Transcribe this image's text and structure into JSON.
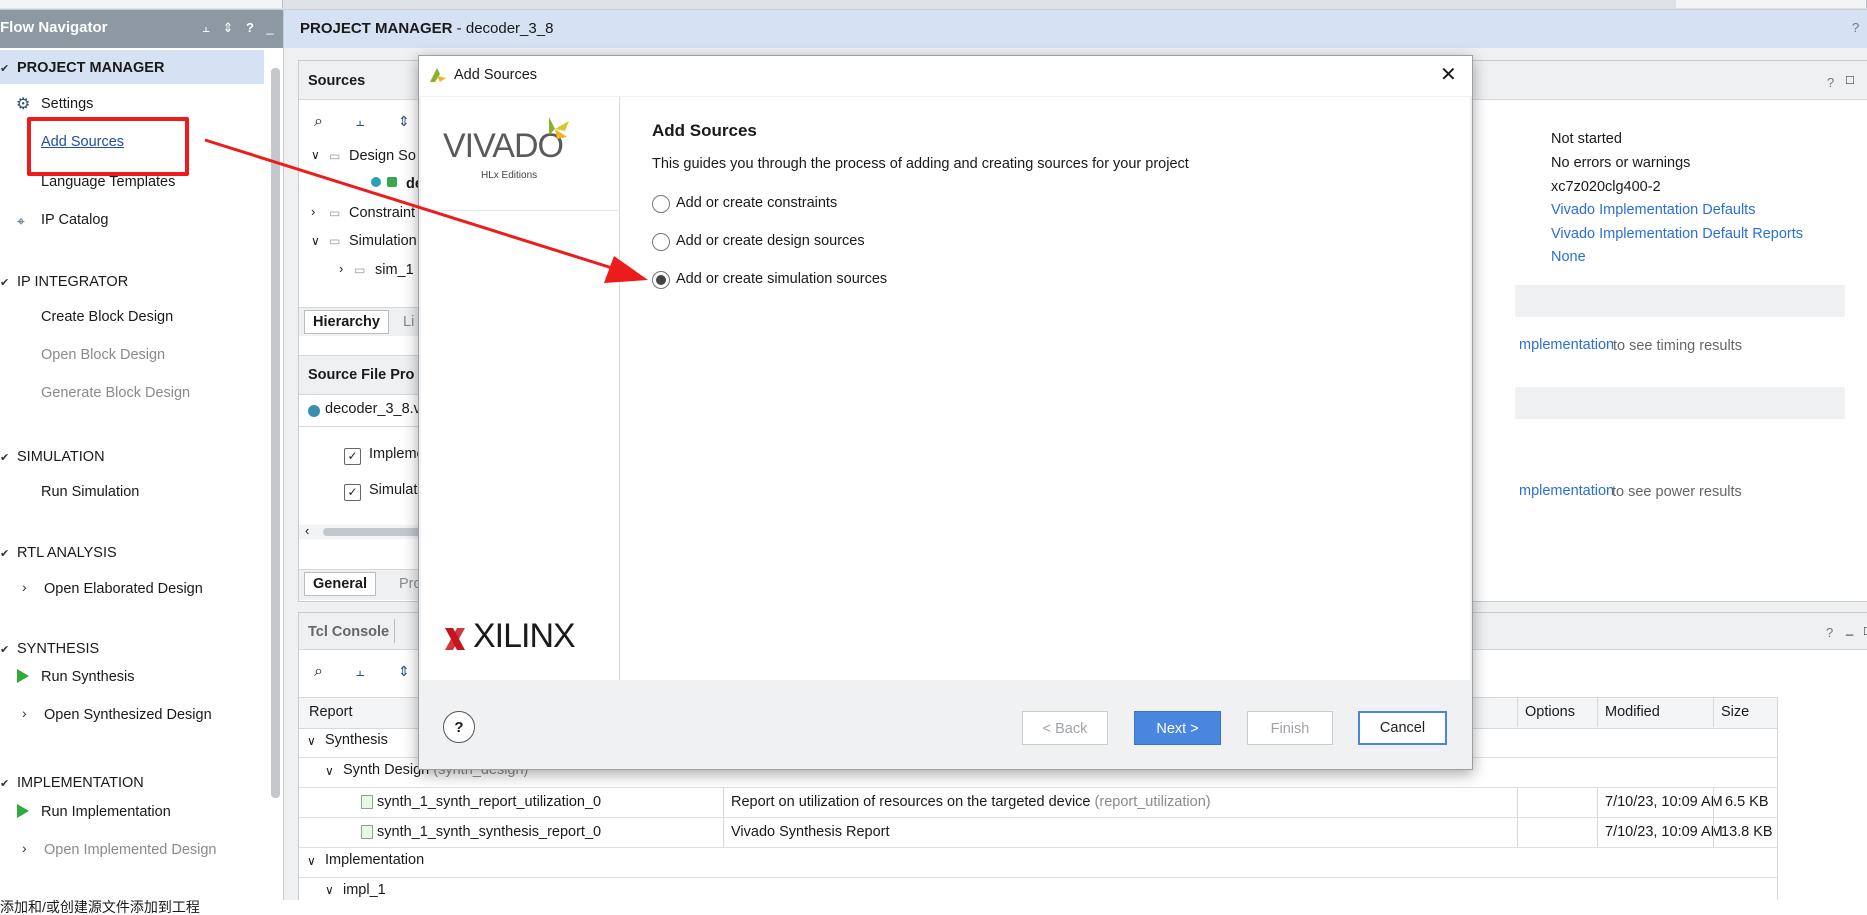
{
  "flow_navigator": {
    "title": "Flow Navigator",
    "sections": [
      {
        "id": "pm",
        "label": "PROJECT MANAGER",
        "items": [
          {
            "label": "Settings",
            "icon": "gear-icon"
          },
          {
            "label": "Add Sources"
          },
          {
            "label": "Language Templates"
          },
          {
            "label": "IP Catalog",
            "icon": "ip-catalog-icon"
          }
        ]
      },
      {
        "id": "ipi",
        "label": "IP INTEGRATOR",
        "items": [
          {
            "label": "Create Block Design"
          },
          {
            "label": "Open Block Design"
          },
          {
            "label": "Generate Block Design"
          }
        ]
      },
      {
        "id": "sim",
        "label": "SIMULATION",
        "items": [
          {
            "label": "Run Simulation"
          }
        ]
      },
      {
        "id": "rtl",
        "label": "RTL ANALYSIS",
        "items": [
          {
            "label": "Open Elaborated Design"
          }
        ]
      },
      {
        "id": "syn",
        "label": "SYNTHESIS",
        "items": [
          {
            "label": "Run Synthesis"
          },
          {
            "label": "Open Synthesized Design"
          }
        ]
      },
      {
        "id": "impl",
        "label": "IMPLEMENTATION",
        "items": [
          {
            "label": "Run Implementation"
          },
          {
            "label": "Open Implemented Design"
          }
        ]
      }
    ]
  },
  "main_header": {
    "bold": "PROJECT MANAGER",
    "rest": " - decoder_3_8"
  },
  "sources_panel": {
    "title": "Sources",
    "tree": [
      {
        "label": "Design So"
      },
      {
        "label": "dec"
      },
      {
        "label": "Constraint"
      },
      {
        "label": "Simulation"
      },
      {
        "label": "sim_1"
      }
    ],
    "tab_hierarchy": "Hierarchy",
    "tab_li": "Li"
  },
  "source_file_props": {
    "title": "Source File Pro",
    "file": "decoder_3_8.v",
    "cb_impl": "Impleme",
    "cb_sim": "Simulat",
    "tab_general": "General",
    "tab_pro": "Pro"
  },
  "summary": {
    "values": [
      "Not started",
      "No errors or warnings",
      "xc7z020clg400-2"
    ],
    "links": [
      "Vivado Implementation Defaults",
      "Vivado Implementation Default Reports",
      "None"
    ],
    "timing_link": "mplementation",
    "timing_text": "to see timing results",
    "power_link": "mplementation",
    "power_text": "to see power results"
  },
  "tcl_console": {
    "title": "Tcl Console"
  },
  "reports": {
    "headers": {
      "report": "Report",
      "options": "Options",
      "modified": "Modified",
      "size": "Size"
    },
    "groups": {
      "synthesis": "Synthesis",
      "synth_design": "Synth Design",
      "synth_design_muted": "(synth_design)",
      "implementation": "Implementation",
      "impl_1": "impl_1"
    },
    "rows": [
      {
        "name": "synth_1_synth_report_utilization_0",
        "desc": "Report on utilization of resources on the targeted device",
        "desc_muted": "(report_utilization)",
        "modified": "7/10/23, 10:09 AM",
        "size": "6.5 KB"
      },
      {
        "name": "synth_1_synth_synthesis_report_0",
        "desc": "Vivado Synthesis Report",
        "desc_muted": "",
        "modified": "7/10/23, 10:09 AM",
        "size": "13.8 KB"
      }
    ]
  },
  "dialog": {
    "title": "Add Sources",
    "logo_vivado": "VIVADO",
    "logo_hlx": "HLx Editions",
    "logo_xilinx": "XILINX",
    "heading": "Add Sources",
    "description": "This guides you through the process of adding and creating sources for your project",
    "options": [
      {
        "label": "Add or create constraints",
        "selected": false
      },
      {
        "label": "Add or create design sources",
        "selected": false
      },
      {
        "label": "Add or create simulation sources",
        "selected": true
      }
    ],
    "buttons": {
      "help": "?",
      "back": "< Back",
      "next": "Next >",
      "finish": "Finish",
      "cancel": "Cancel"
    }
  },
  "status_text": "添加和/或创建源文件添加到工程",
  "colors": {
    "accent": "#4a86e0",
    "annotation": "#ee1b1b",
    "play": "#2eac3a",
    "link": "#2b6fd6"
  }
}
